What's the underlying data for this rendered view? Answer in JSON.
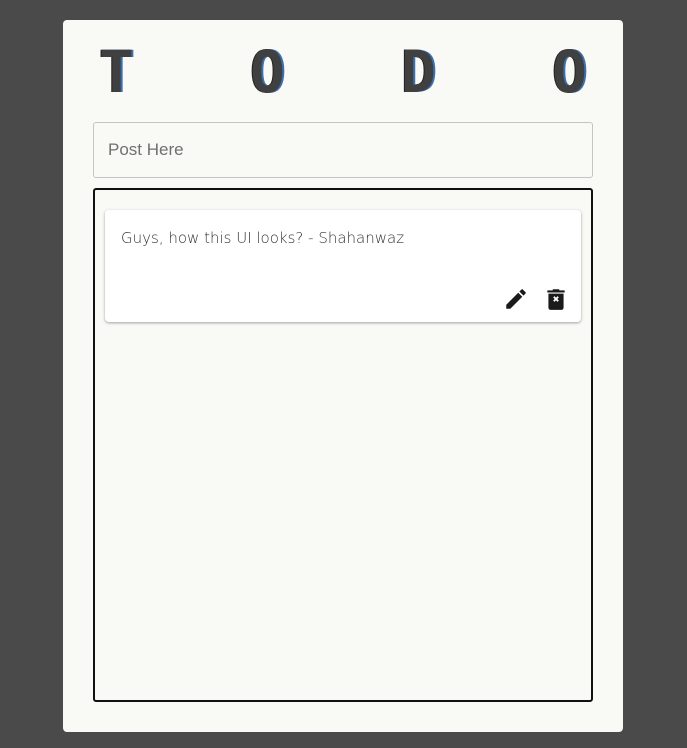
{
  "app": {
    "title_letters": [
      "T",
      "O",
      "D",
      "O"
    ]
  },
  "composer": {
    "placeholder": "Post Here"
  },
  "todos": [
    {
      "text": "Guys, how this UI looks? - Shahanwaz",
      "actions": [
        {
          "icon": "pencil-icon",
          "name": "edit"
        },
        {
          "icon": "trash-x-icon",
          "name": "delete"
        }
      ]
    }
  ]
}
